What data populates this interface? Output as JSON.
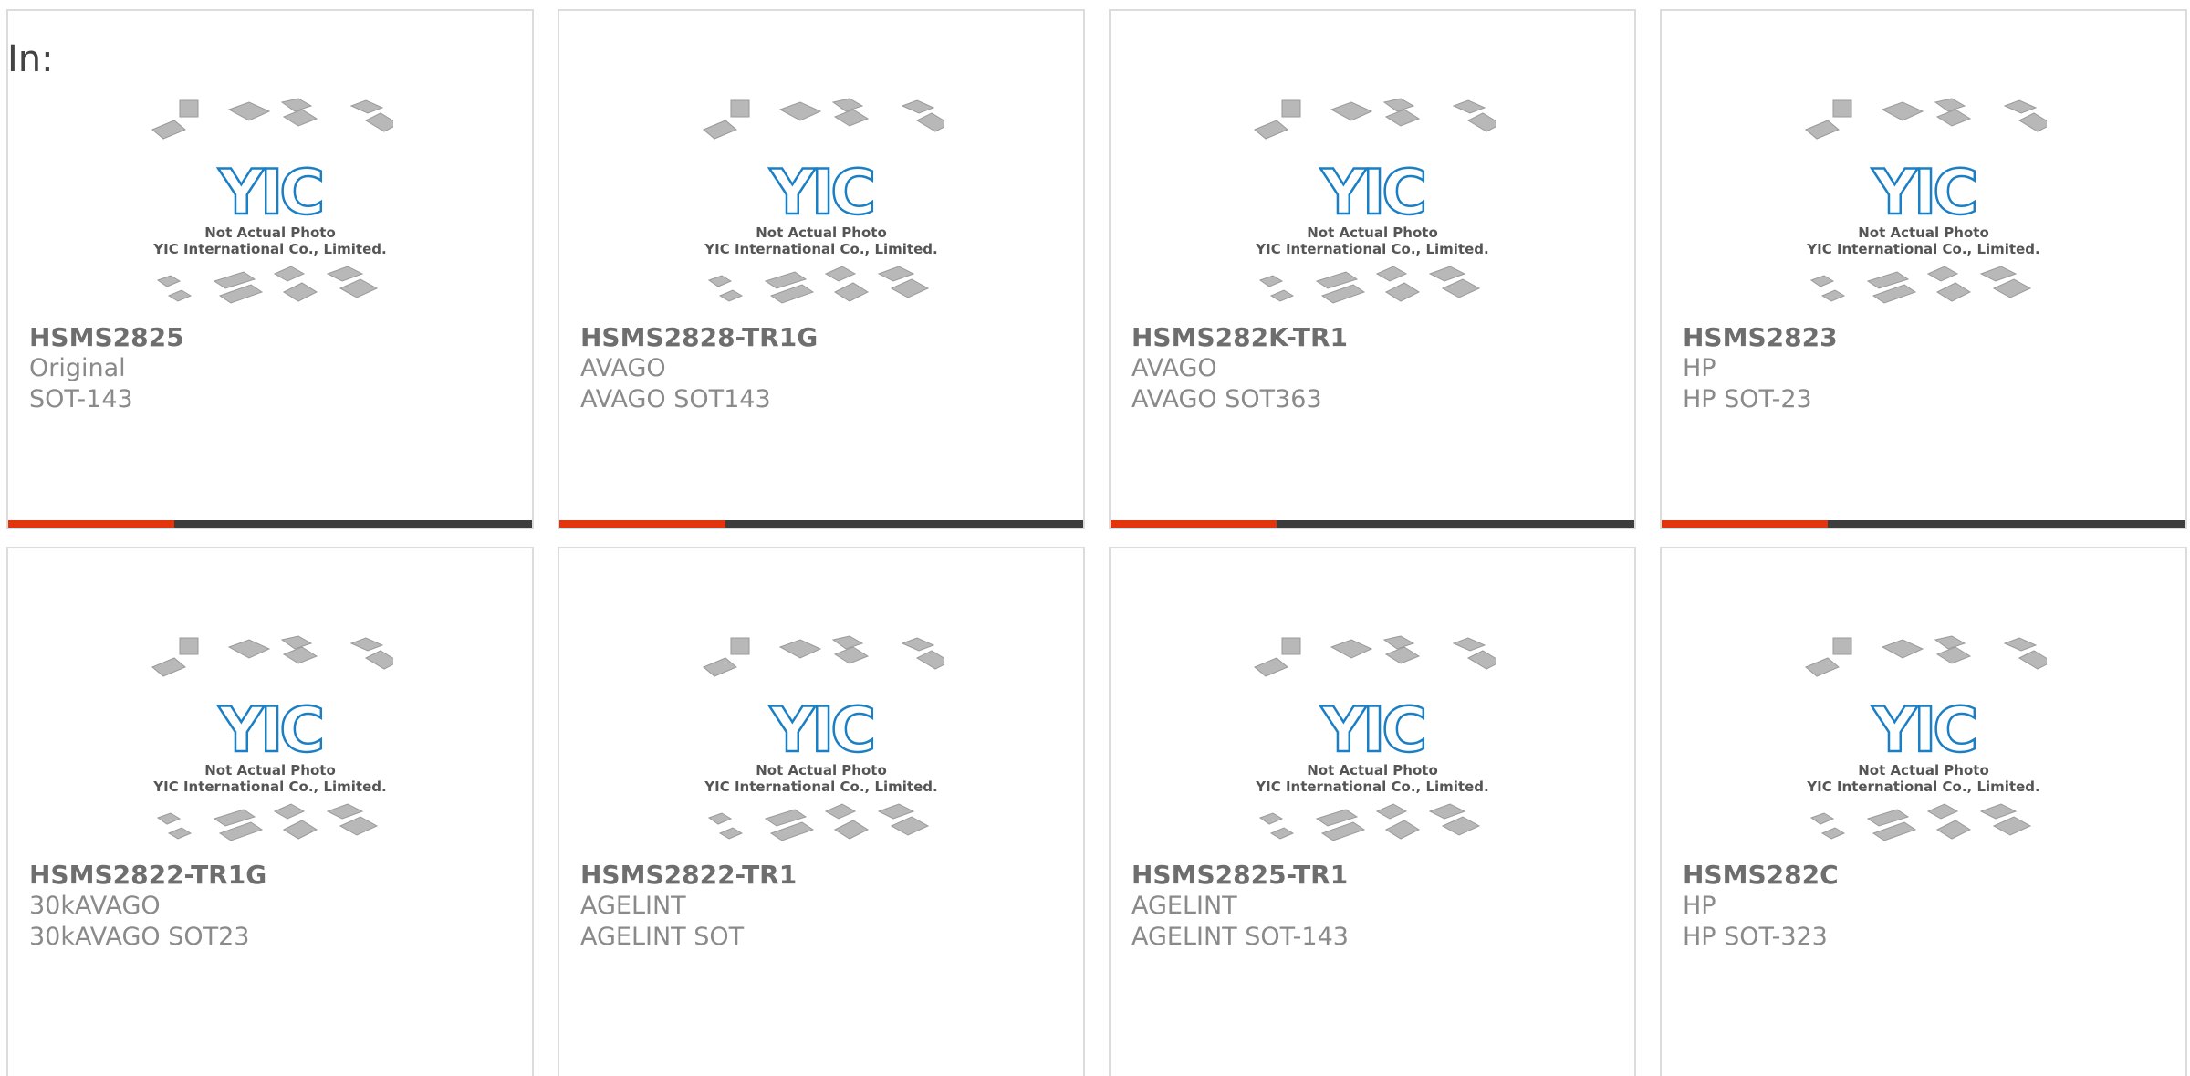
{
  "header": {
    "in_label": "In:"
  },
  "thumbnail": {
    "logo_text": "YIC",
    "caption_line1": "Not Actual Photo",
    "caption_line2": "YIC International Co., Limited.",
    "logo_color": "#1a7fc4"
  },
  "colors": {
    "accent_bar": "#e3350d",
    "dark_bar": "#3d3d3d",
    "card_border": "#dcdcdc"
  },
  "products": [
    {
      "part_no": "HSMS2825",
      "brand": "Original",
      "package": "SOT-143"
    },
    {
      "part_no": "HSMS2828-TR1G",
      "brand": "AVAGO",
      "package": "AVAGO SOT143"
    },
    {
      "part_no": "HSMS282K-TR1",
      "brand": "AVAGO",
      "package": "AVAGO SOT363"
    },
    {
      "part_no": "HSMS2823",
      "brand": "HP",
      "package": "HP SOT-23"
    },
    {
      "part_no": "HSMS2822-TR1G",
      "brand": "30kAVAGO",
      "package": "30kAVAGO SOT23"
    },
    {
      "part_no": "HSMS2822-TR1",
      "brand": "AGELINT",
      "package": "AGELINT SOT"
    },
    {
      "part_no": "HSMS2825-TR1",
      "brand": "AGELINT",
      "package": "AGELINT SOT-143"
    },
    {
      "part_no": "HSMS282C",
      "brand": "HP",
      "package": "HP SOT-323"
    }
  ]
}
